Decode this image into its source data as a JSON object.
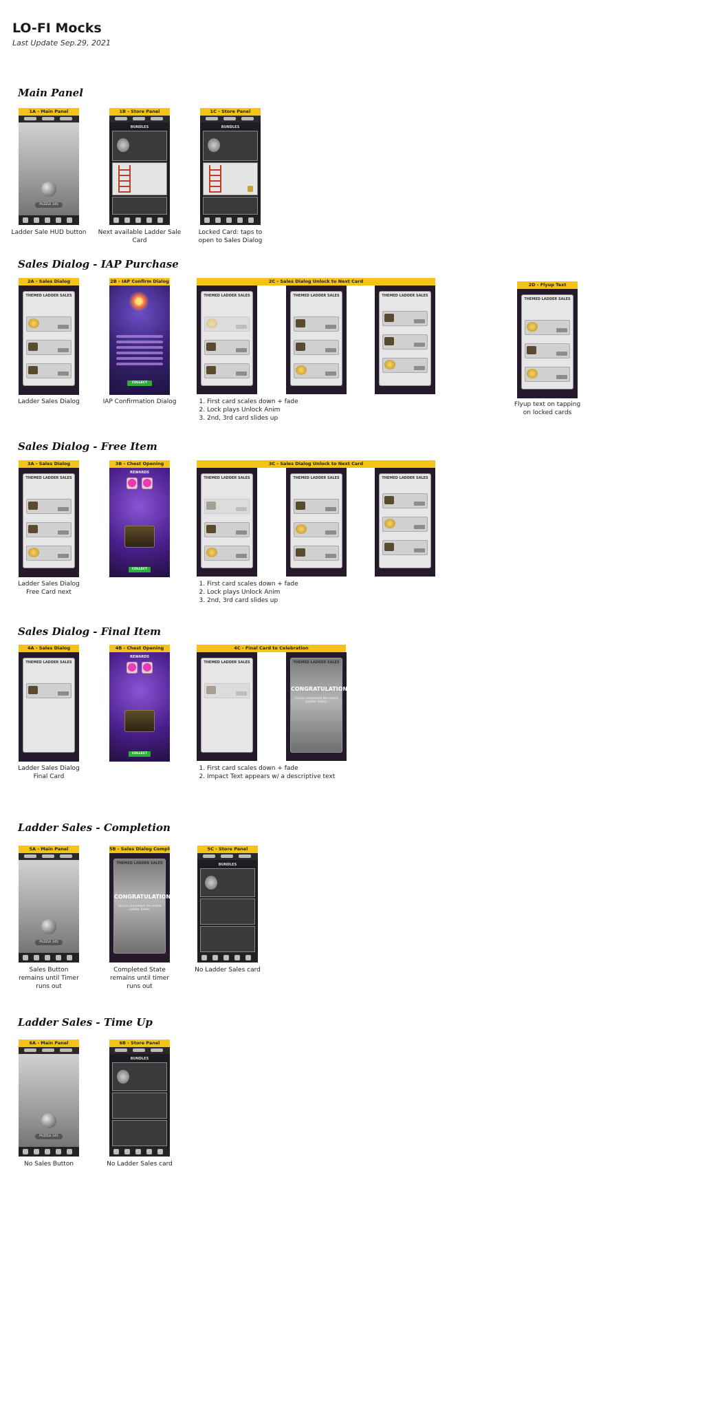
{
  "doc": {
    "title": "LO-FI Mocks",
    "subtitle": "Last Update Sep.29, 2021"
  },
  "sections": {
    "main_panel": "Main Panel",
    "iap": "Sales Dialog - IAP Purchase",
    "free": "Sales Dialog - Free Item",
    "final": "Sales Dialog - Final Item",
    "completion": "Ladder Sales - Completion",
    "timeup": "Ladder Sales - Time Up"
  },
  "cards": {
    "c1a": {
      "header": "1A - Main Panel",
      "caption": "Ladder Sale HUD button"
    },
    "c1b": {
      "header": "1B - Store Panel",
      "caption": "Next available Ladder Sale Card"
    },
    "c1c": {
      "header": "1C - Store Panel",
      "caption": "Locked Card: taps to open to Sales Dialog"
    },
    "c2a": {
      "header": "2A - Sales Dialog",
      "caption": "Ladder Sales Dialog"
    },
    "c2b": {
      "header": "2B - IAP Confirm Dialog",
      "caption": "IAP Confirmation Dialog"
    },
    "c2c": {
      "header": "2C - Sales Dialog Unlock to Next Card"
    },
    "c2d": {
      "header": "2D - Flyup Text",
      "caption": "Flyup text on tapping on locked cards"
    },
    "c3a": {
      "header": "3A - Sales Dialog",
      "caption": "Ladder Sales Dialog Free Card next"
    },
    "c3b": {
      "header": "3B - Chest Opening"
    },
    "c3c": {
      "header": "3C - Sales Dialog Unlock to Next Card"
    },
    "c4a": {
      "header": "4A - Sales Dialog",
      "caption": "Ladder Sales Dialog Final Card"
    },
    "c4b": {
      "header": "4B - Chest Opening"
    },
    "c4c": {
      "header": "4C - Final Card to Celebration"
    },
    "c5a": {
      "header": "5A - Main Panel",
      "caption": "Sales Button remains until Timer runs out"
    },
    "c5b": {
      "header": "5B - Sales Dialog Complete",
      "caption": "Completed State remains until timer runs out"
    },
    "c5c": {
      "header": "5C - Store Panel",
      "caption": "No Ladder Sales card"
    },
    "c6a": {
      "header": "6A - Main Panel",
      "caption": "No Sales Button"
    },
    "c6b": {
      "header": "6B - Store Panel",
      "caption": "No Ladder Sales card"
    }
  },
  "steps": {
    "unlock": [
      "First card scales down + fade",
      "Lock plays Unlock Anim",
      "2nd, 3rd card slides up"
    ],
    "final": [
      "First card scales down + fade",
      "Impact Text appears w/ a descriptive text"
    ]
  },
  "mock_text": {
    "dialog_title": "THEMED LADDER SALES",
    "bundles": "BUNDLES",
    "rewards": "REWARDS",
    "collect": "COLLECT",
    "congrats": "CONGRATULATIONS",
    "congrats_sub": "You've completed the entire Ladder Sales!",
    "puzzle": "PUZZLE 245",
    "free": "FREE"
  },
  "colors": {
    "header_bg": "#f3c318",
    "collect_green": "#2fae3a"
  }
}
